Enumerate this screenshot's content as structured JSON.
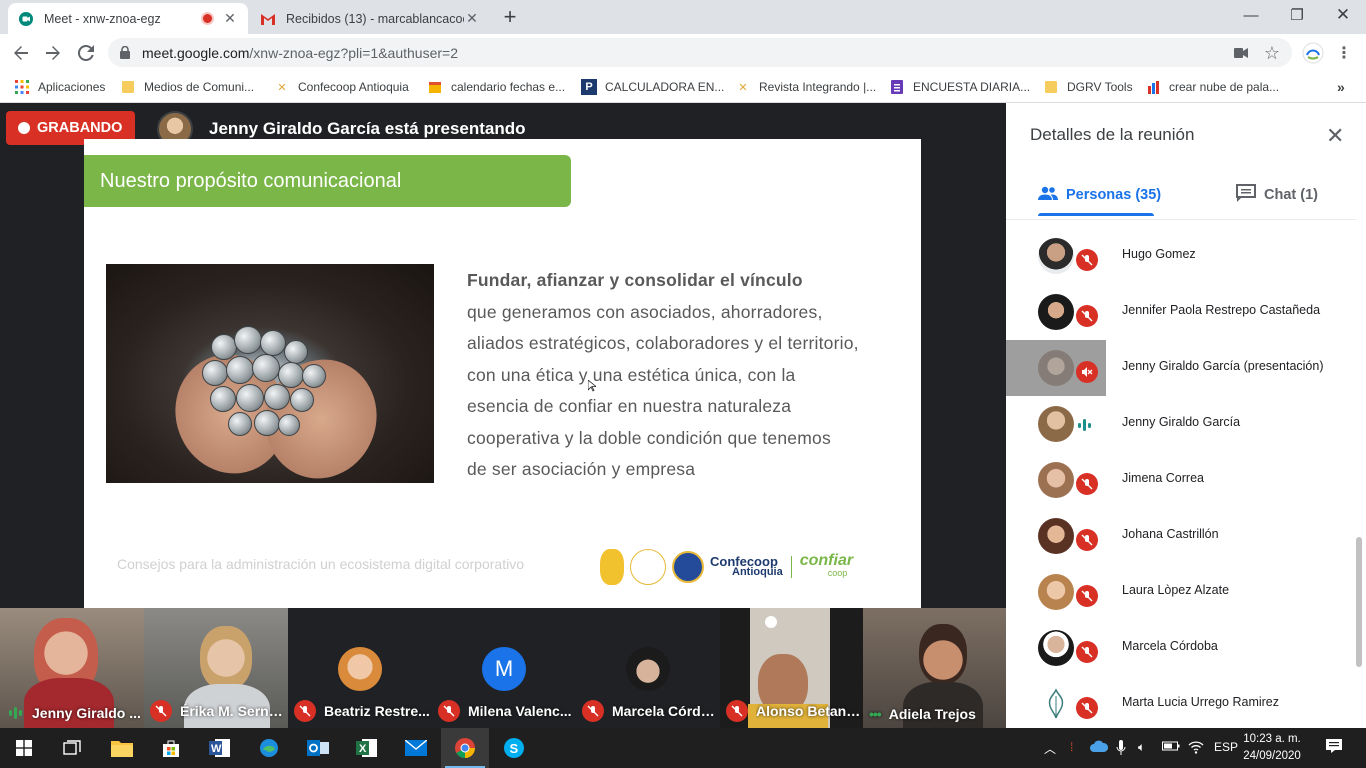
{
  "browser": {
    "tabs": [
      {
        "title": "Meet - xnw-znoa-egz",
        "icon": "meet-icon",
        "recording": true
      },
      {
        "title": "Recibidos (13) - marcablancacoop",
        "icon": "gmail-icon"
      }
    ],
    "url_host": "meet.google.com",
    "url_path": "/xnw-znoa-egz?pli=1&authuser=2",
    "bookmarks": [
      {
        "label": "Aplicaciones",
        "icon": "apps-grid-icon"
      },
      {
        "label": "Medios de Comuni...",
        "icon": "folder-icon"
      },
      {
        "label": "Confecoop Antioquia",
        "icon": "confecoop-icon"
      },
      {
        "label": "calendario fechas e...",
        "icon": "calendar-icon"
      },
      {
        "label": "CALCULADORA EN...",
        "icon": "p-icon"
      },
      {
        "label": "Revista Integrando |...",
        "icon": "confecoop-icon"
      },
      {
        "label": "ENCUESTA DIARIA...",
        "icon": "forms-icon"
      },
      {
        "label": "DGRV Tools",
        "icon": "folder-icon"
      },
      {
        "label": "crear nube de pala...",
        "icon": "wordcloud-icon"
      }
    ]
  },
  "meet": {
    "recording_label": "GRABANDO",
    "presenting_text": "Jenny Giraldo García está presentando",
    "slide": {
      "header": "Nuestro propósito comunicacional",
      "lead": "Fundar, afianzar y consolidar el vínculo",
      "body_lines": [
        "que generamos con asociados, ahorradores,",
        "aliados estratégicos, colaboradores y el territorio,",
        "con una ética y una estética única, con la",
        "esencia de confiar en nuestra naturaleza",
        "cooperativa y la doble condición que tenemos",
        "de ser asociación y empresa"
      ],
      "footer": "Consejos para la administración un ecosistema digital corporativo",
      "logos": {
        "confecoop": "Confecoop",
        "confecoop_sub": "Antioquia",
        "confiar": "confiar",
        "confiar_sub": "coop"
      }
    },
    "filmstrip": [
      {
        "name": "Jenny Giraldo ...",
        "state": "speaking"
      },
      {
        "name": "Érika M. Serna...",
        "state": "muted"
      },
      {
        "name": "Beatriz Restre...",
        "state": "muted"
      },
      {
        "name": "Milena Valenc...",
        "state": "muted",
        "letter": "M"
      },
      {
        "name": "Marcela Córdo...",
        "state": "muted"
      },
      {
        "name": "Alonso Betanc...",
        "state": "muted"
      },
      {
        "name": "Adiela Trejos",
        "state": "active"
      }
    ]
  },
  "panel": {
    "title": "Detalles de la reunión",
    "tabs": [
      {
        "label": "Personas (35)",
        "icon": "people-icon",
        "selected": true
      },
      {
        "label": "Chat (1)",
        "icon": "chat-icon",
        "selected": false
      }
    ],
    "participants": [
      {
        "name": "Hugo Gomez",
        "state": "muted"
      },
      {
        "name": "Jennifer Paola Restrepo Castañeda",
        "state": "muted"
      },
      {
        "name": "Jenny Giraldo García (presentación)",
        "state": "presenting-muted"
      },
      {
        "name": "Jenny Giraldo García",
        "state": "speaking"
      },
      {
        "name": "Jimena Correa",
        "state": "muted"
      },
      {
        "name": "Johana Castrillón",
        "state": "muted"
      },
      {
        "name": "Laura Lòpez Alzate",
        "state": "muted"
      },
      {
        "name": "Marcela Córdoba",
        "state": "muted"
      },
      {
        "name": "Marta Lucia Urrego Ramirez",
        "state": "muted"
      }
    ]
  },
  "taskbar": {
    "apps": [
      "start-icon",
      "task-view-icon",
      "file-explorer-icon",
      "store-icon",
      "word-icon",
      "edge-icon",
      "outlook-icon",
      "excel-icon",
      "mail-icon",
      "chrome-icon",
      "skype-icon"
    ],
    "language": "ESP",
    "time": "10:23 a. m.",
    "date": "24/09/2020"
  },
  "colors": {
    "record_red": "#d93025",
    "slide_green": "#7ab648",
    "meet_blue": "#1a73e8",
    "meet_bg": "#202124"
  }
}
